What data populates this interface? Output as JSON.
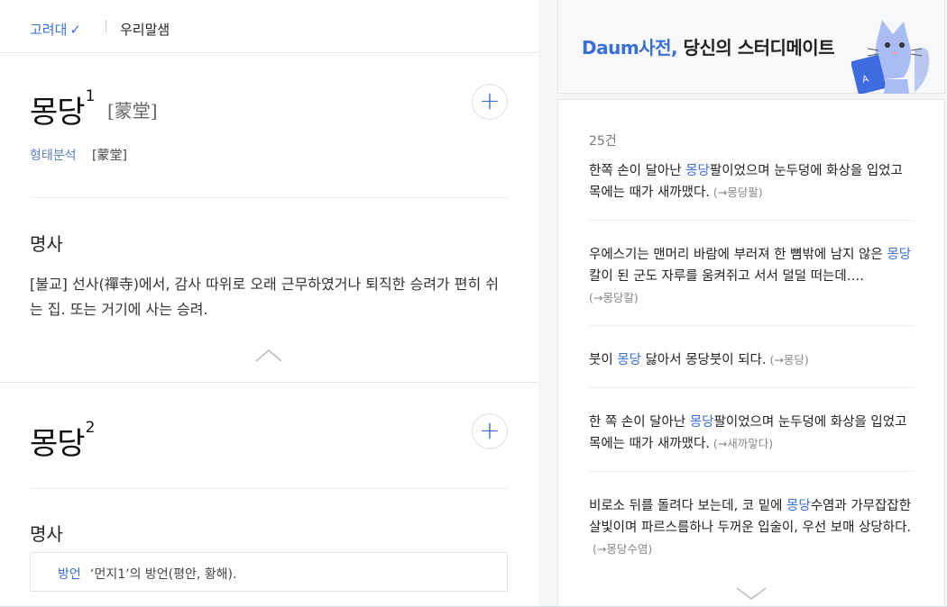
{
  "tabs": {
    "korea": "고려대",
    "urimal": "우리말샘"
  },
  "entry1": {
    "word": "몽당",
    "sup": "1",
    "hanja": "[蒙堂]",
    "plus": "+",
    "morph_label": "형태분석",
    "morph_value": "[蒙堂]",
    "pos": "명사",
    "definition": "[불교] 선사(禪寺)에서, 감사 따위로 오래 근무하였거나 퇴직한 승려가 편히 쉬는 집. 또는 거기에 사는 승려."
  },
  "entry2": {
    "word": "몽당",
    "sup": "2",
    "plus": "+",
    "pos": "명사",
    "dialect_label": "방언",
    "dialect_text": "‘먼지1’의 방언(평안, 황해)."
  },
  "promo": {
    "brand": "Daum사전,",
    "tagline": " 당신의 스터디메이트"
  },
  "examples": {
    "count": "25건",
    "items": [
      {
        "pre": "한쪽 손이 달아난 ",
        "hl": "몽당",
        "post": "팔이었으며 눈두덩에 화상을 입었고 목에는 때가 새까맸다.",
        "src": "(→몽당팔)"
      },
      {
        "pre": "우에스기는 맨머리 바람에 부러져 한 뼘밖에 남지 않은 ",
        "hl": "몽당",
        "post": "칼이 된 군도 자루를 움켜쥐고 서서 덜덜 떠는데….",
        "src": "(→몽당칼)"
      },
      {
        "pre": "붓이 ",
        "hl": "몽당",
        "post": " 닳아서 몽당붓이 되다.",
        "src": "(→몽당)"
      },
      {
        "pre": "한 쪽 손이 달아난 ",
        "hl": "몽당",
        "post": "팔이었으며 눈두덩에 화상을 입었고 목에는 때가 새까맸다.",
        "src": "(→새까맣다)"
      },
      {
        "pre": "비로소 뒤를 돌려다 보는데, 코 밑에 ",
        "hl": "몽당",
        "post": "수염과 가무잡잡한 살빛이며 파르스름하나 두꺼운 입술이, 우선 보매 상당하다.",
        "src": "(→몽당수염)"
      }
    ]
  },
  "colors": {
    "accent": "#3a6fd8"
  }
}
